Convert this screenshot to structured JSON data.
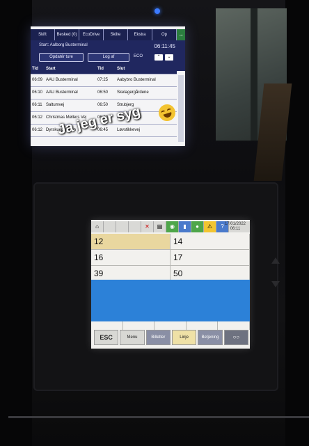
{
  "top_screen": {
    "tabs": [
      "Skift",
      "Besked (0)",
      "EcoDrive",
      "Skilte",
      "Ekstra",
      "Op"
    ],
    "arrow": "→",
    "start_label": "Start: Aalborg Busterminal",
    "clock": "06:11:45",
    "update_button": "Opdatér ture",
    "logout_button": "Log af",
    "eco_label": "ECO",
    "columns": [
      "Tid",
      "Start",
      "Tid",
      "Slut"
    ],
    "rows": [
      {
        "t1": "06:09",
        "start": "AAU Busterminal",
        "t2": "07:25",
        "end": "Aabybro Busterminal"
      },
      {
        "t1": "06:10",
        "start": "AAU Busterminal",
        "t2": "06:50",
        "end": "Skelagergårdene"
      },
      {
        "t1": "06:11",
        "start": "Saltumvej",
        "t2": "06:50",
        "end": "Strubjerg"
      },
      {
        "t1": "06:12",
        "start": "Christmas Møllers Vej",
        "t2": "06:30",
        "end": "Aalborg Nord"
      },
      {
        "t1": "06:12",
        "start": "Dyrskuepladsen",
        "t2": "06:45",
        "end": "Løvstikkevej"
      }
    ]
  },
  "caption": "Ja jeg er syg",
  "device_screen": {
    "date": "17/01/2022",
    "time": "06:11",
    "cells": [
      [
        "12",
        "14"
      ],
      [
        "16",
        "17"
      ],
      [
        "39",
        "50"
      ]
    ],
    "menu": [
      "ESC",
      "Menu",
      "Billetter",
      "Linje",
      "Betjening",
      "○○"
    ]
  },
  "colors": {
    "top_screen_header": "#20275f",
    "device_blue_band": "#2c81d8",
    "selected_cell": "#e9d79f"
  }
}
